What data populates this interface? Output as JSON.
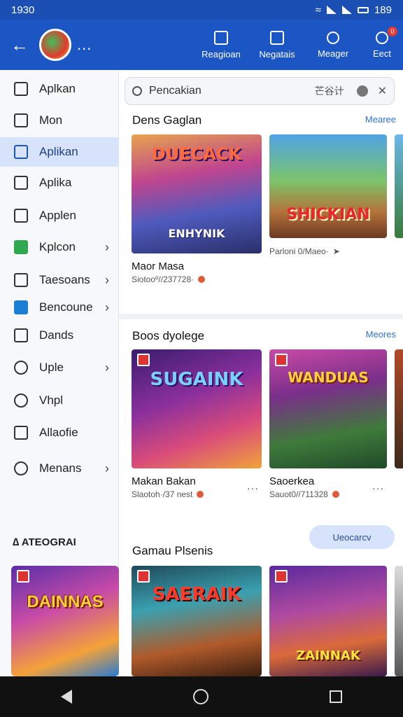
{
  "status": {
    "time": "1930",
    "right_time": "189"
  },
  "appbar": {
    "back_icon": "arrow-left-icon",
    "more": "...",
    "actions": [
      {
        "label": "Reagioan",
        "icon": "square-icon"
      },
      {
        "label": "Negatais",
        "icon": "gift-icon"
      },
      {
        "label": "Meager",
        "icon": "pin-icon"
      },
      {
        "label": "Eect",
        "icon": "gear-icon",
        "badge": "0"
      }
    ]
  },
  "sidebar": {
    "items": [
      {
        "label": "Aplkan",
        "icon": "home-icon"
      },
      {
        "label": "Mon",
        "icon": "phone-icon"
      },
      {
        "label": "Aplikan",
        "icon": "store-icon",
        "active": true
      },
      {
        "label": "Aplika",
        "icon": "square-icon"
      },
      {
        "label": "Applen",
        "icon": "camera-icon"
      },
      {
        "label": "Kplcon",
        "icon": "cube-icon",
        "chevron": true
      },
      {
        "label": "Taesoans",
        "icon": "square-icon",
        "chevron": true
      },
      {
        "label": "Bencoune",
        "icon": "chart-icon",
        "chevron": true
      },
      {
        "label": "Dands",
        "icon": "box-icon"
      },
      {
        "label": "Uple",
        "icon": "user-icon",
        "chevron": true
      },
      {
        "label": "Vhpl",
        "icon": "shield-icon"
      },
      {
        "label": "Allaofie",
        "icon": "square-icon"
      },
      {
        "label": "Menans",
        "icon": "fan-icon",
        "chevron": true
      }
    ],
    "section": "∆ ATEOGRAI",
    "card_title": "DAINNAS"
  },
  "search": {
    "placeholder": "Pencakian",
    "cjk": "芒谷计"
  },
  "sections": [
    {
      "title": "Dens Gaglan",
      "more": "Mearee",
      "tiles": [
        {
          "name": "Maor Masa",
          "meta": "Siotooº//237728·",
          "poster": "DUECACK",
          "poster2": "ENHYNIK"
        },
        {
          "name": "",
          "meta": "Parloni 0/Maeo·",
          "poster": "SHICKIAN"
        }
      ]
    },
    {
      "title": "Boos dyolege",
      "more": "Meores",
      "tiles": [
        {
          "name": "Makan Bakan",
          "meta": "Slaotoh·/37 nest",
          "poster": "SUGAINK"
        },
        {
          "name": "Saoerkea",
          "meta": "Sauot0//711328",
          "poster": "WANDUAS"
        }
      ]
    },
    {
      "title": "Gamau Plsenis",
      "pill": "Ueocarcv",
      "tiles": [
        {
          "poster": "SAERAIK"
        },
        {
          "poster": "ZAINNAK"
        }
      ]
    }
  ],
  "colors": {
    "appbar": "#1c55c4",
    "active": "#d6e3fb",
    "link": "#2a73d8"
  }
}
